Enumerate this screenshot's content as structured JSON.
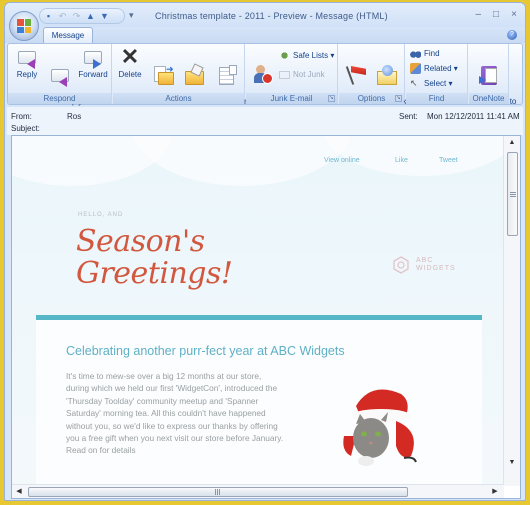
{
  "window": {
    "title": "Christmas template - 2011 - Preview - Message (HTML)",
    "controls": {
      "minimize": "–",
      "maximize": "□",
      "close": "×"
    }
  },
  "quick_access": {
    "icons": [
      "save-icon",
      "undo-icon",
      "redo-icon",
      "previous-item-icon",
      "next-item-icon"
    ],
    "customize_glyph": "▾"
  },
  "tabs": [
    {
      "label": "Message",
      "active": true
    }
  ],
  "help_glyph": "?",
  "ribbon": {
    "groups": [
      {
        "label": "Respond",
        "buttons": [
          {
            "label": "Reply"
          },
          {
            "label": "Reply\nto All"
          },
          {
            "label": "Forward"
          }
        ]
      },
      {
        "label": "Actions",
        "buttons": [
          {
            "label": "Delete"
          },
          {
            "label": "Move to\nFolder ▾"
          },
          {
            "label": "Create\nRule"
          },
          {
            "label": "Other\nActions ▾"
          }
        ]
      },
      {
        "label": "Junk E-mail",
        "buttons": [
          {
            "label": "Block\nSender"
          },
          {
            "label": "Safe Lists ▾"
          },
          {
            "label": "Not Junk",
            "disabled": true
          }
        ]
      },
      {
        "label": "Options",
        "buttons": [
          {
            "label": "Follow\nUp ▾"
          },
          {
            "label": "Mark as\nUnread"
          }
        ]
      },
      {
        "label": "Find",
        "buttons": [
          {
            "label": "Find"
          },
          {
            "label": "Related ▾"
          },
          {
            "label": "Select ▾"
          }
        ]
      },
      {
        "label": "OneNote",
        "buttons": [
          {
            "label": "Send to\nOneNote"
          }
        ]
      }
    ]
  },
  "header": {
    "from_label": "From:",
    "from_value": "Ros",
    "subject_label": "Subject:",
    "subject_value": "",
    "sent_label": "Sent:",
    "sent_value": "Mon 12/12/2011 11:41 AM"
  },
  "email": {
    "links": [
      "View online",
      "Like",
      "Tweet"
    ],
    "hello": "HELLO, AND",
    "greeting_line1": "Season's",
    "greeting_line2": "Greetings!",
    "brand_line1": "ABC",
    "brand_line2": "WIDGETS",
    "headline": "Celebrating another purr-fect year at ABC Widgets",
    "paragraph": "It's time to mew-se over a big 12 months at our store, during which we held our first 'WidgetCon', introduced the 'Thursday Toolday' community meetup and 'Spanner Saturday' morning tea. All this couldn't have happened without you, so we'd like to express our thanks by offering you a free gift when you next visit our store before January.",
    "read_on": "Read on for details",
    "image_alt": "kitten-in-santa-hat",
    "colors": {
      "accent": "#56b7c6",
      "greeting": "#d2573f",
      "headline": "#5fb0c6",
      "body_text": "#9aa0a4"
    }
  },
  "scrollbars": {
    "up": "▲",
    "down": "▼",
    "left": "◀",
    "right": "▶"
  }
}
